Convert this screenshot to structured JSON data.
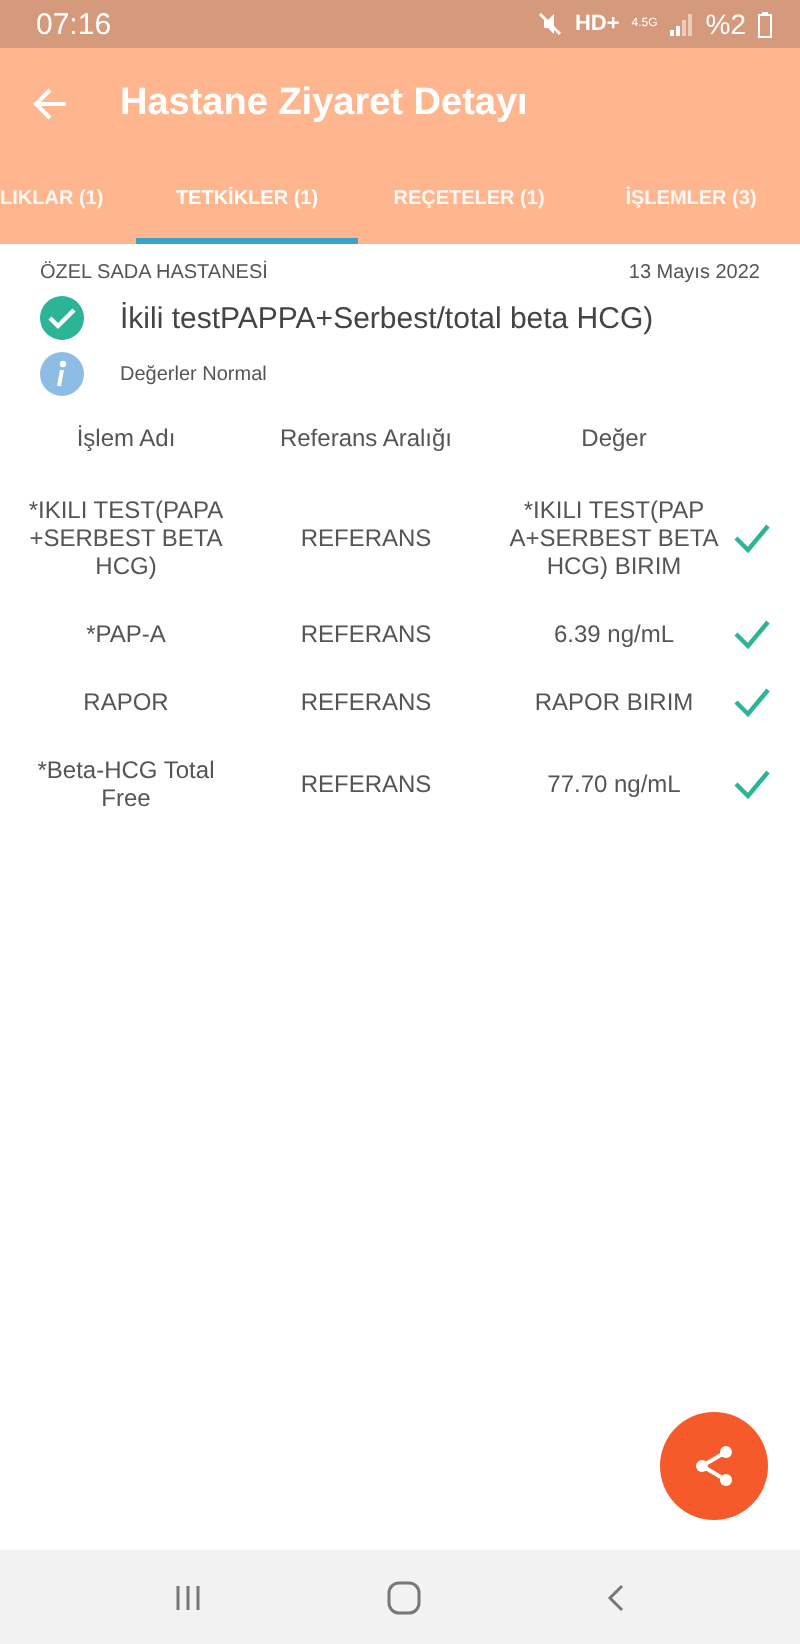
{
  "status_bar": {
    "time": "07:16",
    "network": "HD+",
    "generation": "4.5G",
    "battery": "%2"
  },
  "app_bar": {
    "title": "Hastane Ziyaret Detayı"
  },
  "tabs": [
    {
      "label": "LIKLAR (1)",
      "selected": false
    },
    {
      "label": "TETKİKLER (1)",
      "selected": true
    },
    {
      "label": "REÇETELER (1)",
      "selected": false
    },
    {
      "label": "İŞLEMLER (3)",
      "selected": false
    }
  ],
  "visit": {
    "hospital": "ÖZEL SADA HASTANESİ",
    "date": "13 Mayıs 2022",
    "test_name": "İkili testPAPPA+Serbest/total beta HCG)",
    "test_done": true,
    "info": "Değerler Normal"
  },
  "table": {
    "columns": [
      "İşlem Adı",
      "Referans Aralığı",
      "Değer"
    ],
    "rows": [
      {
        "name": "*IKILI TEST(PAPA +SERBEST BETA HCG)",
        "reference": "REFERANS",
        "value": "*IKILI TEST(PAP A+SERBEST BETA HCG) BIRIM",
        "normal": true
      },
      {
        "name": "*PAP-A",
        "reference": "REFERANS",
        "value": "6.39 ng/mL",
        "normal": true
      },
      {
        "name": "RAPOR",
        "reference": "REFERANS",
        "value": "RAPOR BIRIM",
        "normal": true
      },
      {
        "name": "*Beta-HCG Total Free",
        "reference": "REFERANS",
        "value": "77.70 ng/mL",
        "normal": true
      }
    ]
  }
}
